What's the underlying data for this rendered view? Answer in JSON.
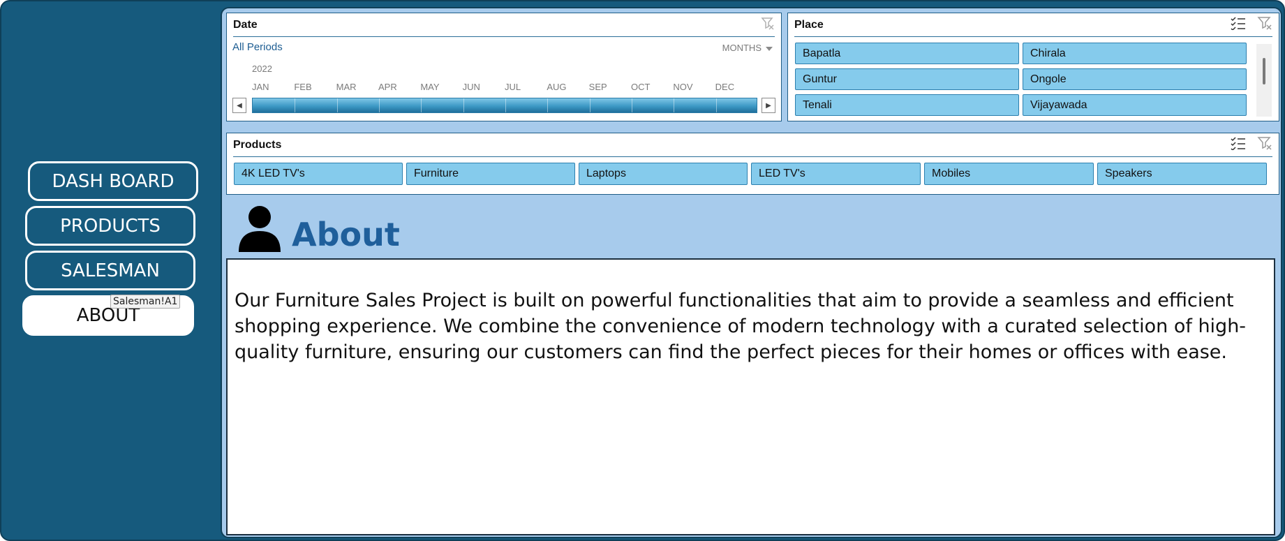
{
  "nav": {
    "dashboard": "DASH BOARD",
    "products": "PRODUCTS",
    "salesman": "SALESMAN",
    "about": "ABOUT",
    "tooltip": "Salesman!A1"
  },
  "date_slicer": {
    "title": "Date",
    "period_link": "All Periods",
    "level": "MONTHS",
    "year": "2022",
    "months": [
      "JAN",
      "FEB",
      "MAR",
      "APR",
      "MAY",
      "JUN",
      "JUL",
      "AUG",
      "SEP",
      "OCT",
      "NOV",
      "DEC"
    ]
  },
  "place_slicer": {
    "title": "Place",
    "items": [
      "Bapatla",
      "Chirala",
      "Guntur",
      "Ongole",
      "Tenali",
      "Vijayawada"
    ]
  },
  "products_slicer": {
    "title": "Products",
    "items": [
      "4K LED TV's",
      "Furniture",
      "Laptops",
      "LED TV's",
      "Mobiles",
      "Speakers"
    ]
  },
  "about": {
    "heading": "About",
    "body": "Our Furniture Sales Project is built on powerful functionalities that aim to provide a seamless and efficient shopping experience. We combine the convenience of modern technology with a curated selection of high-quality furniture, ensuring our customers can find the perfect pieces for their homes or offices with ease."
  },
  "colors": {
    "sidebar_bg": "#165a7d",
    "panel_bg": "#a7cbec",
    "tile_bg": "#85cbec",
    "heading": "#1f5f9b"
  },
  "icons": [
    "clear-filter-icon",
    "multi-select-icon",
    "person-icon",
    "scroll-left-icon",
    "scroll-right-icon",
    "dropdown-arrow-icon"
  ]
}
